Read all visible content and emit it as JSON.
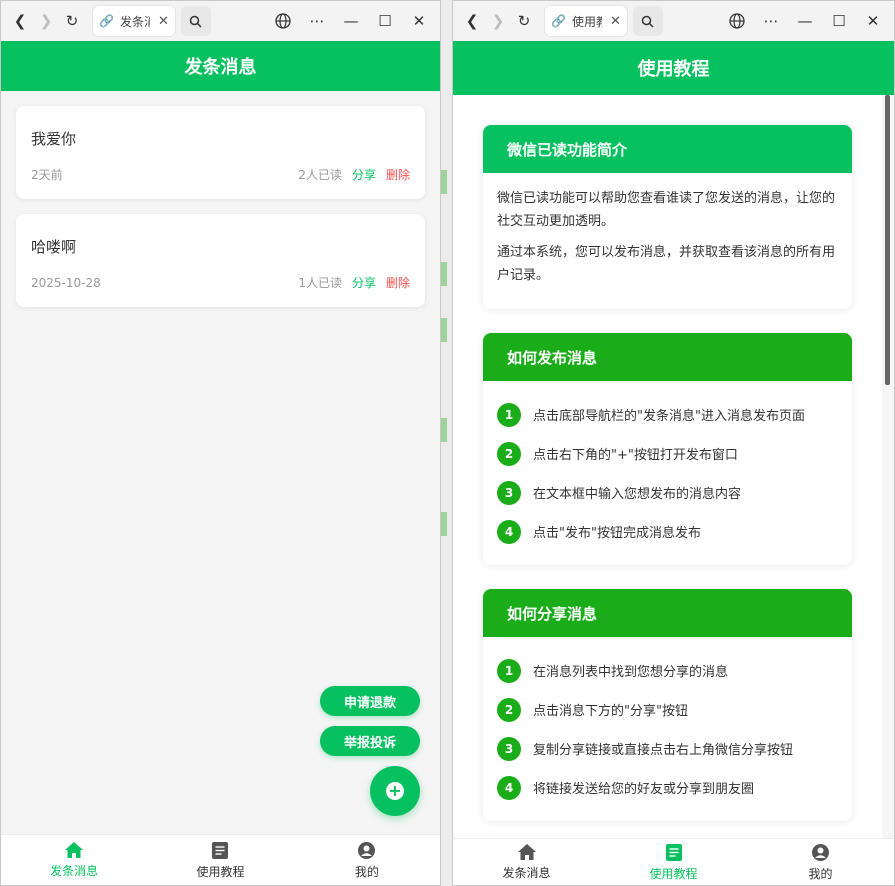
{
  "browser": {
    "window1_tab_title": "发条消息",
    "window2_tab_title": "使用教程"
  },
  "window1": {
    "header_title": "发条消息",
    "messages": [
      {
        "text": "我爱你",
        "time": "2天前",
        "read": "2人已读",
        "share": "分享",
        "delete": "删除"
      },
      {
        "text": "哈喽啊",
        "time": "2025-10-28",
        "read": "1人已读",
        "share": "分享",
        "delete": "删除"
      }
    ],
    "refund_button": "申请退款",
    "report_button": "举报投诉"
  },
  "window2": {
    "header_title": "使用教程",
    "sections": [
      {
        "title": "微信已读功能简介",
        "paragraphs": [
          "微信已读功能可以帮助您查看谁读了您发送的消息，让您的社交互动更加透明。",
          "通过本系统，您可以发布消息，并获取查看该消息的所有用户记录。"
        ]
      },
      {
        "title": "如何发布消息",
        "steps": [
          {
            "num": "1",
            "text": "点击底部导航栏的\"发条消息\"进入消息发布页面"
          },
          {
            "num": "2",
            "text": "点击右下角的\"+\"按钮打开发布窗口"
          },
          {
            "num": "3",
            "text": "在文本框中输入您想发布的消息内容"
          },
          {
            "num": "4",
            "text": "点击\"发布\"按钮完成消息发布"
          }
        ]
      },
      {
        "title": "如何分享消息",
        "steps": [
          {
            "num": "1",
            "text": "在消息列表中找到您想分享的消息"
          },
          {
            "num": "2",
            "text": "点击消息下方的\"分享\"按钮"
          },
          {
            "num": "3",
            "text": "复制分享链接或直接点击右上角微信分享按钮"
          },
          {
            "num": "4",
            "text": "将链接发送给您的好友或分享到朋友圈"
          }
        ]
      }
    ]
  },
  "tabbar": {
    "items": [
      {
        "label": "发条消息",
        "icon": "home-icon"
      },
      {
        "label": "使用教程",
        "icon": "document-icon"
      },
      {
        "label": "我的",
        "icon": "user-icon"
      }
    ]
  },
  "colors": {
    "primary": "#07c160",
    "secondary": "#1aad19",
    "danger": "#fa5151"
  }
}
